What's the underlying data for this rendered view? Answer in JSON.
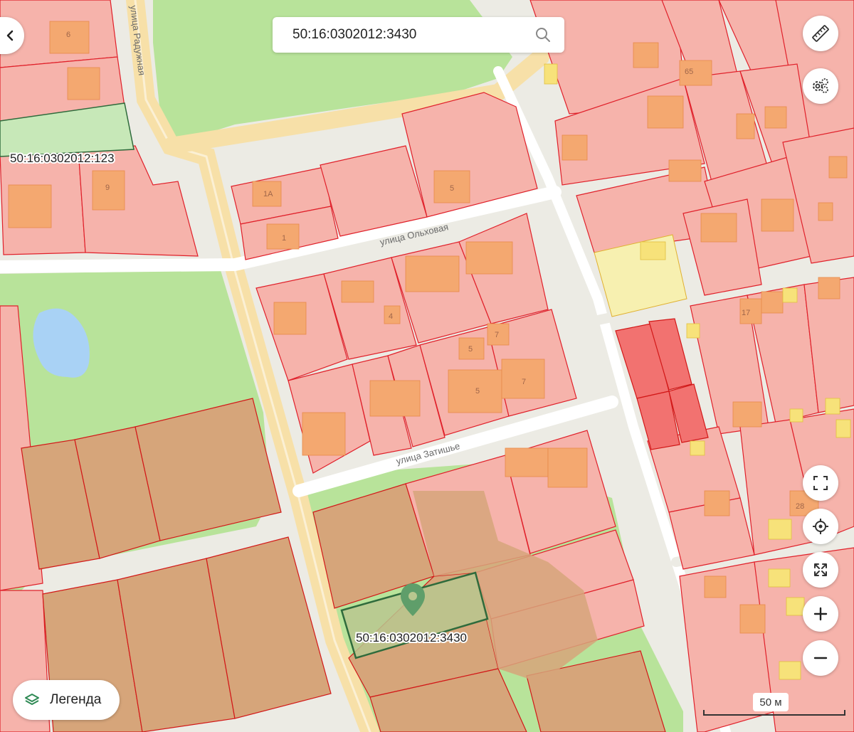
{
  "search": {
    "value": "50:16:0302012:3430"
  },
  "streets": {
    "raduzhnaya": "улица Радужная",
    "olkhovaya": "улица Ольховая",
    "zatishye": "улица Затишье"
  },
  "parcel_labels": {
    "top_left": "50:16:0302012:123",
    "selected": "50:16:0302012:3430"
  },
  "house_numbers": {
    "n6": "6",
    "n9": "9",
    "n1a": "1А",
    "n1": "1",
    "n5a": "5",
    "n4": "4",
    "n5b": "5",
    "n7a": "7",
    "n5c": "5",
    "n7b": "7",
    "n65": "65",
    "n17": "17",
    "n28": "28"
  },
  "legend": {
    "label": "Легенда",
    "icon": "layers-icon"
  },
  "scale": {
    "label": "50 м"
  },
  "controls": {
    "ruler": "ruler-icon",
    "settings": "settings-gears-icon",
    "fullscreen": "fullscreen-icon",
    "locate": "locate-icon",
    "fit": "fit-bounds-icon",
    "zoom_in": "plus-icon",
    "zoom_out": "minus-icon",
    "back": "chevron-left-icon",
    "search_icon": "search-icon"
  },
  "colors": {
    "parcel_fill": "#f6b3ab",
    "parcel_stroke": "#e0202a",
    "building": "#f4a870",
    "brown_parcel": "#d6a57a",
    "selected_stroke": "#2f6b3c",
    "green_area": "#b8e39a",
    "road": "#ffffff",
    "main_road": "#f7e0a8"
  }
}
